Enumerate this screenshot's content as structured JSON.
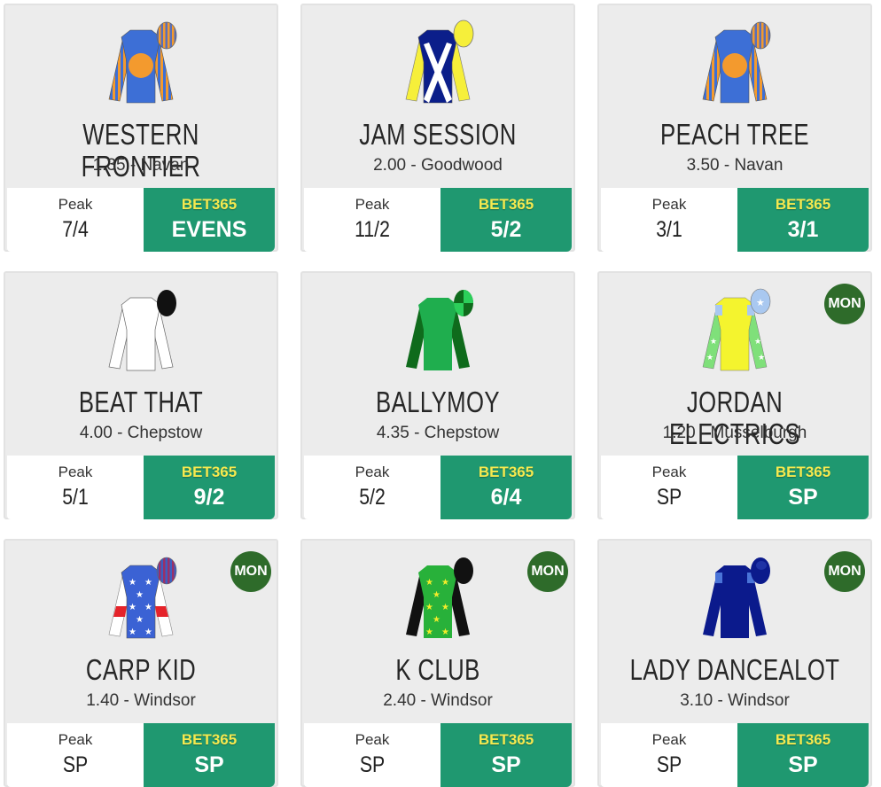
{
  "cards": [
    {
      "name": "WESTERN FRONTIER",
      "race": "1.35 - Navan",
      "peak_label": "Peak",
      "peak": "7/4",
      "bookie": "BET365",
      "odds": "EVENS",
      "badge": ""
    },
    {
      "name": "JAM SESSION",
      "race": "2.00 - Goodwood",
      "peak_label": "Peak",
      "peak": "11/2",
      "bookie": "BET365",
      "odds": "5/2",
      "badge": ""
    },
    {
      "name": "PEACH TREE",
      "race": "3.50 - Navan",
      "peak_label": "Peak",
      "peak": "3/1",
      "bookie": "BET365",
      "odds": "3/1",
      "badge": ""
    },
    {
      "name": "BEAT THAT",
      "race": "4.00 - Chepstow",
      "peak_label": "Peak",
      "peak": "5/1",
      "bookie": "BET365",
      "odds": "9/2",
      "badge": ""
    },
    {
      "name": "BALLYMOY",
      "race": "4.35 - Chepstow",
      "peak_label": "Peak",
      "peak": "5/2",
      "bookie": "BET365",
      "odds": "6/4",
      "badge": ""
    },
    {
      "name": "JORDAN ELECTRICS",
      "race": "1.20 - Musselburgh",
      "peak_label": "Peak",
      "peak": "SP",
      "bookie": "BET365",
      "odds": "SP",
      "badge": "MON"
    },
    {
      "name": "CARP KID",
      "race": "1.40 - Windsor",
      "peak_label": "Peak",
      "peak": "SP",
      "bookie": "BET365",
      "odds": "SP",
      "badge": "MON"
    },
    {
      "name": "K CLUB",
      "race": "2.40 - Windsor",
      "peak_label": "Peak",
      "peak": "SP",
      "bookie": "BET365",
      "odds": "SP",
      "badge": "MON"
    },
    {
      "name": "LADY DANCEALOT",
      "race": "3.10 - Windsor",
      "peak_label": "Peak",
      "peak": "SP",
      "bookie": "BET365",
      "odds": "SP",
      "badge": "MON"
    }
  ],
  "colors": {
    "bet_bg": "#1f9870",
    "bookie_text": "#f5e94f",
    "badge_bg": "#2e6b2a"
  },
  "icons": [
    "silks-western-frontier-icon",
    "silks-jam-session-icon",
    "silks-peach-tree-icon",
    "silks-beat-that-icon",
    "silks-ballymoy-icon",
    "silks-jordan-electrics-icon",
    "silks-carp-kid-icon",
    "silks-k-club-icon",
    "silks-lady-dancealot-icon"
  ]
}
